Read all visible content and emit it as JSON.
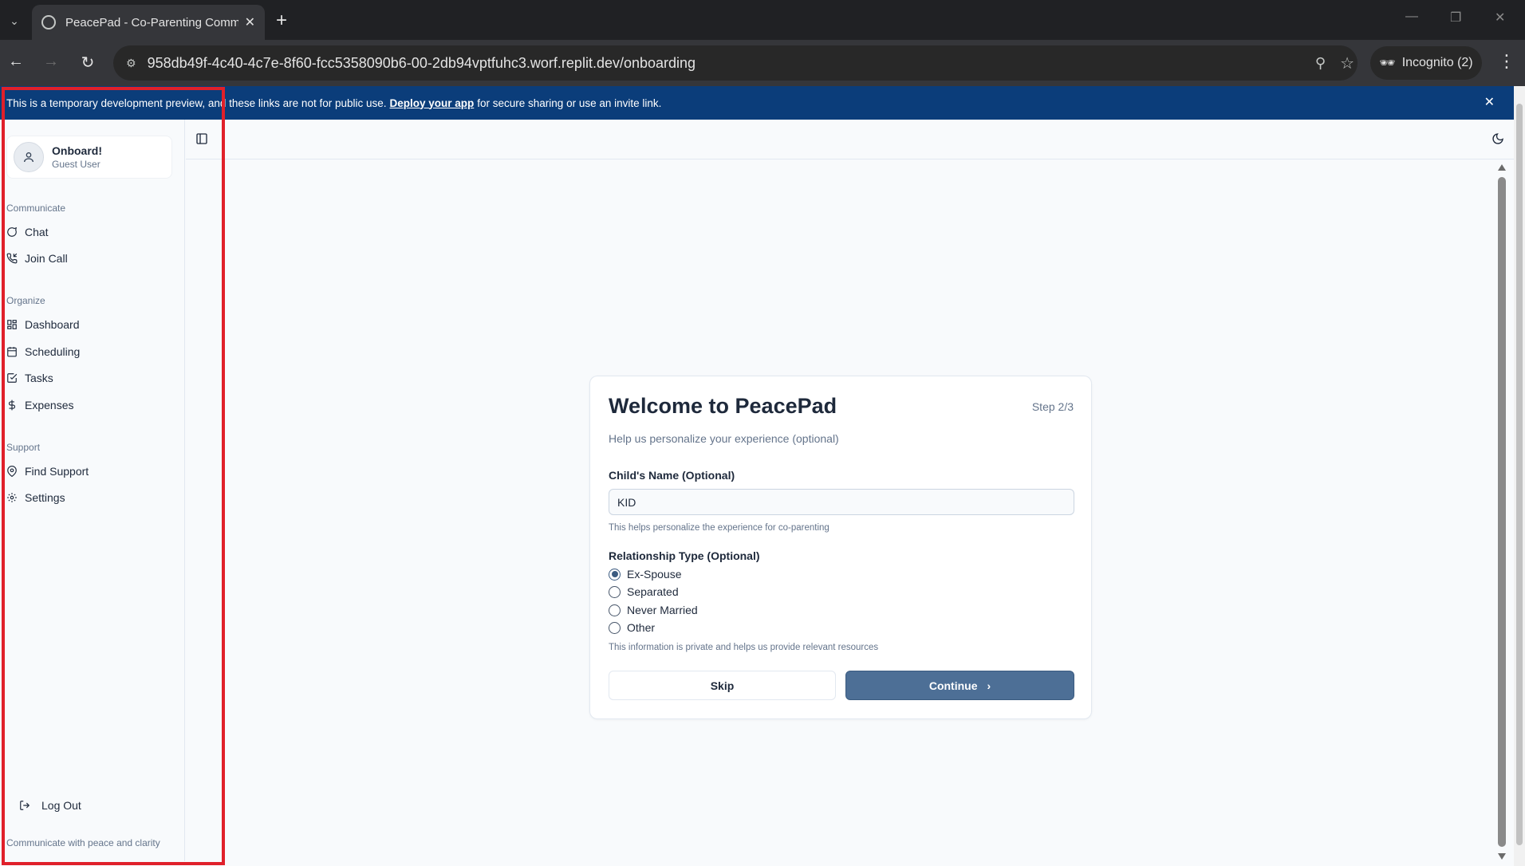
{
  "browser": {
    "tab_title": "PeacePad - Co-Parenting Comm",
    "url_host": "958db49f-4c40-4c7e-8f60-fcc5358090b6-00-2db94vptfuhc3.worf.replit.dev",
    "url_path": "/onboarding",
    "profile": "Incognito (2)"
  },
  "banner": {
    "text_before": "This is a temporary development preview, and these links are not for public use.",
    "link": "Deploy your app",
    "text_after": "for secure sharing or use an invite link."
  },
  "sidebar": {
    "user_name": "Onboard!",
    "user_role": "Guest User",
    "sections": [
      {
        "label": "Communicate",
        "items": [
          {
            "label": "Chat",
            "icon": "message-circle-icon"
          },
          {
            "label": "Join Call",
            "icon": "phone-incoming-icon"
          }
        ]
      },
      {
        "label": "Organize",
        "items": [
          {
            "label": "Dashboard",
            "icon": "layout-dashboard-icon"
          },
          {
            "label": "Scheduling",
            "icon": "calendar-icon"
          },
          {
            "label": "Tasks",
            "icon": "check-square-icon"
          },
          {
            "label": "Expenses",
            "icon": "dollar-sign-icon"
          }
        ]
      },
      {
        "label": "Support",
        "items": [
          {
            "label": "Find Support",
            "icon": "map-pin-icon"
          },
          {
            "label": "Settings",
            "icon": "gear-icon"
          }
        ]
      }
    ],
    "logout": "Log Out",
    "tagline": "Communicate with peace and clarity"
  },
  "onboarding": {
    "title": "Welcome to PeacePad",
    "step": "Step 2/3",
    "subtitle": "Help us personalize your experience (optional)",
    "child_label": "Child's Name (Optional)",
    "child_value": "KID",
    "child_help": "This helps personalize the experience for co-parenting",
    "relationship_label": "Relationship Type (Optional)",
    "relationship_options": [
      "Ex-Spouse",
      "Separated",
      "Never Married",
      "Other"
    ],
    "relationship_selected": "Ex-Spouse",
    "relationship_help": "This information is private and helps us provide relevant resources",
    "skip": "Skip",
    "continue": "Continue"
  },
  "colors": {
    "banner": "#0b3d7a",
    "primary_button": "#4d6f96",
    "highlight": "#e0202a"
  }
}
